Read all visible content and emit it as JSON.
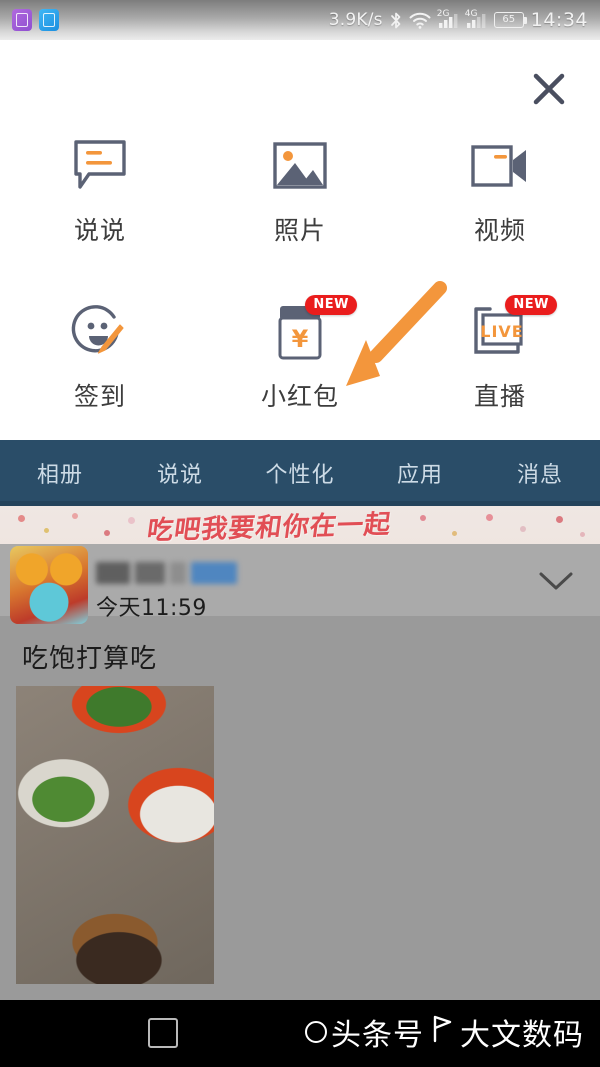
{
  "statusbar": {
    "notif_icons": [
      "app-icon-purple",
      "app-icon-blue"
    ],
    "network_speed": "3.9K/s",
    "bluetooth_icon": "bluetooth-icon",
    "wifi_icon": "wifi-icon",
    "signal_1_label": "2G",
    "signal_2_label": "4G",
    "battery_level": "65",
    "time": "14:34"
  },
  "sheet": {
    "close_icon": "close-icon",
    "items": [
      {
        "label": "说说",
        "icon": "speech-bubble-icon",
        "badge": ""
      },
      {
        "label": "照片",
        "icon": "photo-icon",
        "badge": ""
      },
      {
        "label": "视频",
        "icon": "video-camera-icon",
        "badge": ""
      },
      {
        "label": "签到",
        "icon": "check-in-smiley-icon",
        "badge": ""
      },
      {
        "label": "小红包",
        "icon": "red-packet-icon",
        "badge": "NEW"
      },
      {
        "label": "直播",
        "icon": "live-broadcast-icon",
        "badge": "NEW"
      }
    ],
    "annotation": {
      "icon": "orange-arrow-icon",
      "points_to": "小红包"
    }
  },
  "tabbar": {
    "tabs": [
      {
        "label": "相册"
      },
      {
        "label": "说说"
      },
      {
        "label": "个性化"
      },
      {
        "label": "应用"
      },
      {
        "label": "消息"
      }
    ]
  },
  "feed": {
    "banner_text": "吃吧我要和你在一起",
    "avatar": "user-avatar",
    "username_masked": "",
    "timestamp": "今天11:59",
    "expand_icon": "chevron-down-icon",
    "post_text": "吃饱打算吃",
    "photo": "food-photo"
  },
  "navbar": {
    "recents_icon": "recents-square-icon",
    "watermark_circle_icon": "circle-icon",
    "watermark_label_1": "头条号",
    "watermark_flag_icon": "flag-icon",
    "watermark_label_2": "大文数码"
  },
  "colors": {
    "tabbar_bg": "#2a4d68",
    "badge_red": "#ea1d1d",
    "accent_orange": "#f3963c",
    "icon_slate": "#5b6275"
  }
}
